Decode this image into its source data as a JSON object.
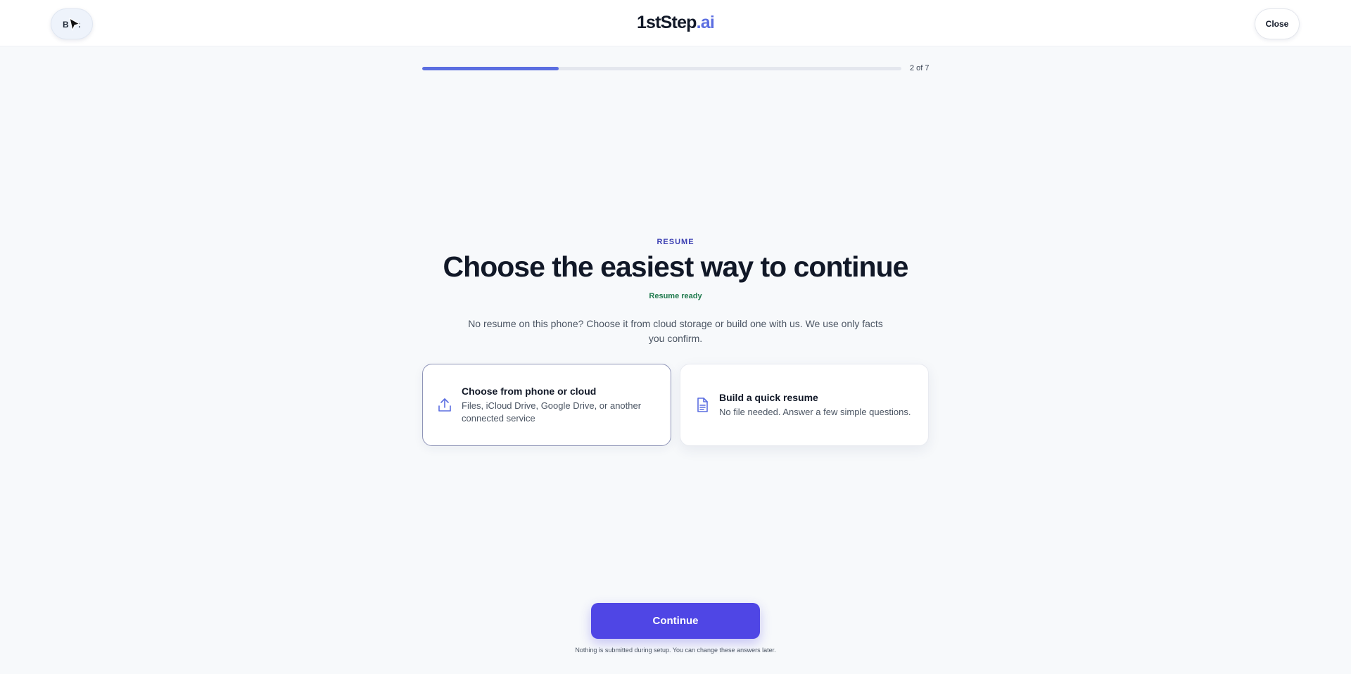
{
  "header": {
    "back_label": "B",
    "back_tail": ":",
    "logo_main": "1stStep",
    "logo_accent": ".ai",
    "close_label": "Close"
  },
  "progress": {
    "label": "2 of 7",
    "fraction": 0.285,
    "color": "#5b6ee1"
  },
  "main": {
    "eyebrow": "RESUME",
    "headline": "Choose the easiest way to continue",
    "status": "Resume ready",
    "description": "No resume on this phone? Choose it from cloud storage or build one with us. We use only facts you confirm."
  },
  "options": [
    {
      "icon": "upload-icon",
      "title": "Choose from phone or cloud",
      "subtitle": "Files, iCloud Drive, Google Drive, or another connected service",
      "selected": true
    },
    {
      "icon": "document-icon",
      "title": "Build a quick resume",
      "subtitle": "No file needed. Answer a few simple questions.",
      "selected": false
    }
  ],
  "footer": {
    "continue_label": "Continue",
    "note": "Nothing is submitted during setup. You can change these answers later."
  },
  "colors": {
    "accent": "#4f46e5",
    "brand": "#5b6ee1",
    "success": "#1f7a4d"
  }
}
